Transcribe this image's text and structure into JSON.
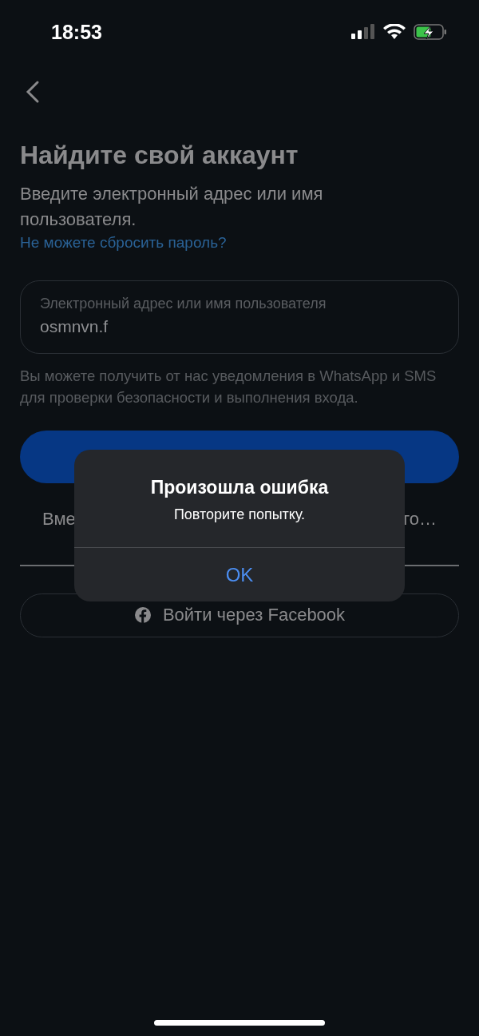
{
  "status_bar": {
    "time": "18:53"
  },
  "title": "Найдите свой аккаунт",
  "subtitle": "Введите электронный адрес или имя пользователя.",
  "help_link": "Не можете сбросить пароль?",
  "field": {
    "label": "Электронный адрес или имя пользователя",
    "value": "osmnvn.f"
  },
  "notice": "Вы можете получить от нас уведомления в WhatsApp и SMS для проверки безопасности и выполнения входа.",
  "alt_row": {
    "left_fragment": "Вме",
    "right_fragment": "го…"
  },
  "facebook_button": "Войти через Facebook",
  "alert": {
    "title": "Произошла ошибка",
    "message": "Повторите попытку.",
    "buttons": [
      "OK"
    ]
  }
}
